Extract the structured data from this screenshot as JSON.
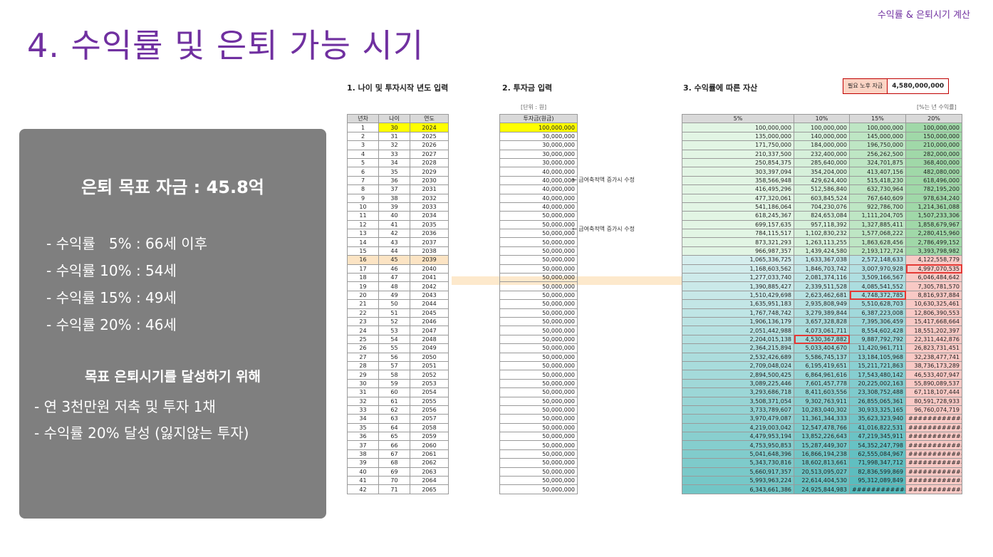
{
  "header": {
    "top_label": "수익률 & 은퇴시기 계산",
    "title": "4. 수익률 및 은퇴 가능 시기"
  },
  "summary": {
    "goal": "은퇴 목표 자금 : 45.8억",
    "rates": [
      "- 수익률   5% : 66세 이후",
      "- 수익률 10% : 54세",
      "- 수익률 15% : 49세",
      "- 수익률 20% : 46세"
    ],
    "subtitle": "목표 은퇴시기를 달성하기 위해",
    "notes": [
      "- 연 3천만원 저축 및 투자 1채",
      "- 수익률 20% 달성 (잃지않는 투자)"
    ]
  },
  "sheet": {
    "section1": "1. 나이 및 투자시작 년도 입력",
    "section2": "2. 투자금 입력",
    "section3": "3. 수익률에 따른 자산",
    "unit_label": "[단위 : 원]",
    "rate_unit_label": "[%는 년 수익률]",
    "required": {
      "label": "필요 노후 자금",
      "value": "4,580,000,000"
    },
    "headers_left": [
      "년차",
      "나이",
      "연도"
    ],
    "header_invest": "투자금(원금)",
    "headers_rates": [
      "5%",
      "10%",
      "15%",
      "20%"
    ],
    "notes": [
      "← 급여축적액 증가시 수정",
      "← 급여축적액 증가시 수정"
    ],
    "rows": [
      [
        "1",
        "30",
        "2024",
        "100,000,000",
        "100,000,000",
        "100,000,000",
        "100,000,000",
        "100,000,000"
      ],
      [
        "2",
        "31",
        "2025",
        "30,000,000",
        "135,000,000",
        "140,000,000",
        "145,000,000",
        "150,000,000"
      ],
      [
        "3",
        "32",
        "2026",
        "30,000,000",
        "171,750,000",
        "184,000,000",
        "196,750,000",
        "210,000,000"
      ],
      [
        "4",
        "33",
        "2027",
        "30,000,000",
        "210,337,500",
        "232,400,000",
        "256,262,500",
        "282,000,000"
      ],
      [
        "5",
        "34",
        "2028",
        "30,000,000",
        "250,854,375",
        "285,640,000",
        "324,701,875",
        "368,400,000"
      ],
      [
        "6",
        "35",
        "2029",
        "40,000,000",
        "303,397,094",
        "354,204,000",
        "413,407,156",
        "482,080,000"
      ],
      [
        "7",
        "36",
        "2030",
        "40,000,000",
        "358,566,948",
        "429,624,400",
        "515,418,230",
        "618,496,000"
      ],
      [
        "8",
        "37",
        "2031",
        "40,000,000",
        "416,495,296",
        "512,586,840",
        "632,730,964",
        "782,195,200"
      ],
      [
        "9",
        "38",
        "2032",
        "40,000,000",
        "477,320,061",
        "603,845,524",
        "767,640,609",
        "978,634,240"
      ],
      [
        "10",
        "39",
        "2033",
        "40,000,000",
        "541,186,064",
        "704,230,076",
        "922,786,700",
        "1,214,361,088"
      ],
      [
        "11",
        "40",
        "2034",
        "50,000,000",
        "618,245,367",
        "824,653,084",
        "1,111,204,705",
        "1,507,233,306"
      ],
      [
        "12",
        "41",
        "2035",
        "50,000,000",
        "699,157,635",
        "957,118,392",
        "1,327,885,411",
        "1,858,679,967"
      ],
      [
        "13",
        "42",
        "2036",
        "50,000,000",
        "784,115,517",
        "1,102,830,232",
        "1,577,068,222",
        "2,280,415,960"
      ],
      [
        "14",
        "43",
        "2037",
        "50,000,000",
        "873,321,293",
        "1,263,113,255",
        "1,863,628,456",
        "2,786,499,152"
      ],
      [
        "15",
        "44",
        "2038",
        "50,000,000",
        "966,987,357",
        "1,439,424,580",
        "2,193,172,724",
        "3,393,798,982"
      ],
      [
        "16",
        "45",
        "2039",
        "50,000,000",
        "1,065,336,725",
        "1,633,367,038",
        "2,572,148,633",
        "4,122,558,779"
      ],
      [
        "17",
        "46",
        "2040",
        "50,000,000",
        "1,168,603,562",
        "1,846,703,742",
        "3,007,970,928",
        "4,997,070,535"
      ],
      [
        "18",
        "47",
        "2041",
        "50,000,000",
        "1,277,033,740",
        "2,081,374,116",
        "3,509,166,567",
        "6,046,484,642"
      ],
      [
        "19",
        "48",
        "2042",
        "50,000,000",
        "1,390,885,427",
        "2,339,511,528",
        "4,085,541,552",
        "7,305,781,570"
      ],
      [
        "20",
        "49",
        "2043",
        "50,000,000",
        "1,510,429,698",
        "2,623,462,681",
        "4,748,372,785",
        "8,816,937,884"
      ],
      [
        "21",
        "50",
        "2044",
        "50,000,000",
        "1,635,951,183",
        "2,935,808,949",
        "5,510,628,703",
        "10,630,325,461"
      ],
      [
        "22",
        "51",
        "2045",
        "50,000,000",
        "1,767,748,742",
        "3,279,389,844",
        "6,387,223,008",
        "12,806,390,553"
      ],
      [
        "23",
        "52",
        "2046",
        "50,000,000",
        "1,906,136,179",
        "3,657,328,828",
        "7,395,306,459",
        "15,417,668,664"
      ],
      [
        "24",
        "53",
        "2047",
        "50,000,000",
        "2,051,442,988",
        "4,073,061,711",
        "8,554,602,428",
        "18,551,202,397"
      ],
      [
        "25",
        "54",
        "2048",
        "50,000,000",
        "2,204,015,138",
        "4,530,367,882",
        "9,887,792,792",
        "22,311,442,876"
      ],
      [
        "26",
        "55",
        "2049",
        "50,000,000",
        "2,364,215,894",
        "5,033,404,670",
        "11,420,961,711",
        "26,823,731,451"
      ],
      [
        "27",
        "56",
        "2050",
        "50,000,000",
        "2,532,426,689",
        "5,586,745,137",
        "13,184,105,968",
        "32,238,477,741"
      ],
      [
        "28",
        "57",
        "2051",
        "50,000,000",
        "2,709,048,024",
        "6,195,419,651",
        "15,211,721,863",
        "38,736,173,289"
      ],
      [
        "29",
        "58",
        "2052",
        "50,000,000",
        "2,894,500,425",
        "6,864,961,616",
        "17,543,480,142",
        "46,533,407,947"
      ],
      [
        "30",
        "59",
        "2053",
        "50,000,000",
        "3,089,225,446",
        "7,601,457,778",
        "20,225,002,163",
        "55,890,089,537"
      ],
      [
        "31",
        "60",
        "2054",
        "50,000,000",
        "3,293,686,718",
        "8,411,603,556",
        "23,308,752,488",
        "67,118,107,444"
      ],
      [
        "32",
        "61",
        "2055",
        "50,000,000",
        "3,508,371,054",
        "9,302,763,911",
        "26,855,065,361",
        "80,591,728,933"
      ],
      [
        "33",
        "62",
        "2056",
        "50,000,000",
        "3,733,789,607",
        "10,283,040,302",
        "30,933,325,165",
        "96,760,074,719"
      ],
      [
        "34",
        "63",
        "2057",
        "50,000,000",
        "3,970,479,087",
        "11,361,344,333",
        "35,623,323,940",
        "############"
      ],
      [
        "35",
        "64",
        "2058",
        "50,000,000",
        "4,219,003,042",
        "12,547,478,766",
        "41,016,822,531",
        "############"
      ],
      [
        "36",
        "65",
        "2059",
        "50,000,000",
        "4,479,953,194",
        "13,852,226,643",
        "47,219,345,911",
        "############"
      ],
      [
        "37",
        "66",
        "2060",
        "50,000,000",
        "4,753,950,853",
        "15,287,449,307",
        "54,352,247,798",
        "############"
      ],
      [
        "38",
        "67",
        "2061",
        "50,000,000",
        "5,041,648,396",
        "16,866,194,238",
        "62,555,084,967",
        "############"
      ],
      [
        "39",
        "68",
        "2062",
        "50,000,000",
        "5,343,730,816",
        "18,602,813,661",
        "71,998,347,712",
        "############"
      ],
      [
        "40",
        "69",
        "2063",
        "50,000,000",
        "5,660,917,357",
        "20,513,095,027",
        "82,836,599,869",
        "############"
      ],
      [
        "41",
        "70",
        "2064",
        "50,000,000",
        "5,993,963,224",
        "22,614,404,530",
        "95,312,089,849",
        "############"
      ],
      [
        "42",
        "71",
        "2065",
        "50,000,000",
        "6,343,661,386",
        "24,925,844,983",
        "############",
        "############"
      ]
    ]
  }
}
